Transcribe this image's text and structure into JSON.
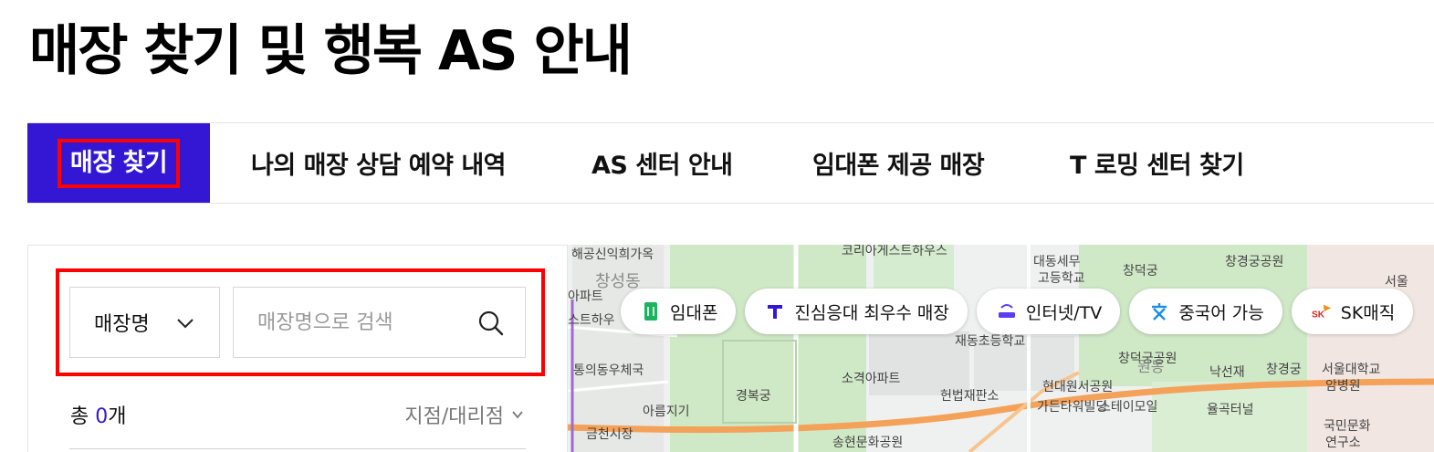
{
  "page": {
    "title": "매장 찾기 및 행복 AS 안내"
  },
  "tabs": [
    {
      "label": "매장 찾기",
      "active": true
    },
    {
      "label": "나의 매장 상담 예약 내역",
      "active": false
    },
    {
      "label": "AS 센터 안내",
      "active": false
    },
    {
      "label": "임대폰 제공 매장",
      "active": false
    },
    {
      "label": "T 로밍 센터 찾기",
      "active": false
    }
  ],
  "search": {
    "select_value": "매장명",
    "placeholder": "매장명으로 검색",
    "value": ""
  },
  "results": {
    "prefix": "총 ",
    "count": "0",
    "suffix": "개",
    "filter_label": "지점/대리점"
  },
  "map": {
    "chips": [
      {
        "label": "임대폰",
        "icon": "phone-rent-icon",
        "color": "#1bb35e"
      },
      {
        "label": "진심응대 최우수 매장",
        "icon": "t-logo-icon",
        "color": "#3417d5"
      },
      {
        "label": "인터넷/TV",
        "icon": "router-icon",
        "color": "#5b3df5"
      },
      {
        "label": "중국어 가능",
        "icon": "chinese-char-icon",
        "color": "#1a8fe0"
      },
      {
        "label": "SK매직",
        "icon": "sk-logo-icon",
        "color": "#e2231a"
      }
    ],
    "labels": [
      "해공신익희가옥",
      "코리아게스트하우스",
      "대동세무",
      "고등학교",
      "창덕궁",
      "창경궁공원",
      "서울",
      "창성동",
      "아파트",
      "스트하우",
      "재동초등학교",
      "창덕궁공원",
      "낙선재",
      "창경궁",
      "서울대학교",
      "암병원",
      "통의동우체국",
      "소격아파트",
      "현대원서공원",
      "경복궁",
      "헌법재판소",
      "가든타워빌딩",
      "스테이모일",
      "율곡터널",
      "아름지기",
      "금천시장",
      "송현문화공원",
      "국민문화",
      "연구소",
      "원동"
    ],
    "colors": {
      "park": "#cfe8c6",
      "road": "#f4a259",
      "block": "#e3e6e4"
    }
  },
  "colors": {
    "accent": "#3417d5",
    "highlight": "#ff0000"
  }
}
